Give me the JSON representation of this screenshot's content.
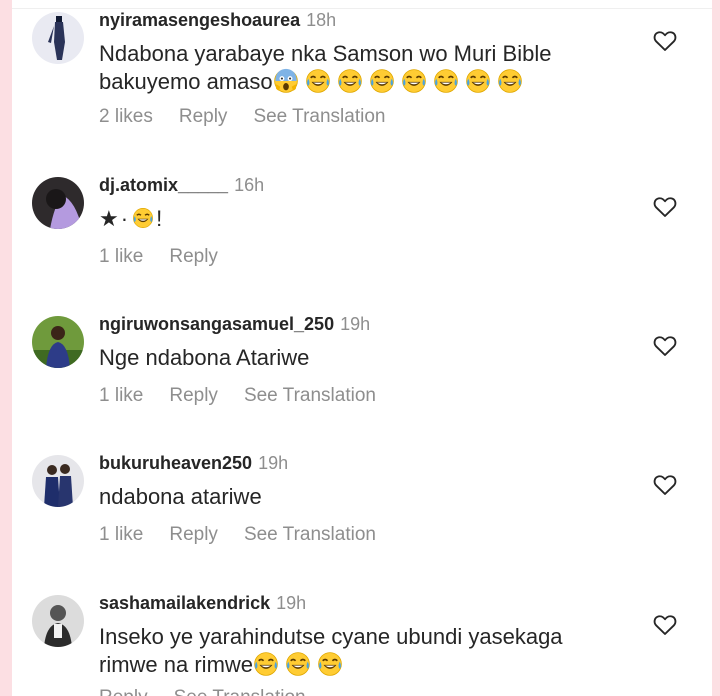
{
  "comments": [
    {
      "username": "nyiramasengeshoaurea",
      "time": "18h",
      "text": "Ndabona yarabaye nka Samson wo Muri Bible bakuyemo amaso",
      "emojis": [
        "scream",
        "joy",
        "joy",
        "joy",
        "joy",
        "joy",
        "joy",
        "joy"
      ],
      "likes": "2 likes",
      "reply": "Reply",
      "translation": "See Translation"
    },
    {
      "username": "dj.atomix_____",
      "time": "16h",
      "text_star": "★",
      "text_dot": "·",
      "text_end": "!",
      "likes": "1 like",
      "reply": "Reply"
    },
    {
      "username": "ngiruwonsangasamuel_250",
      "time": "19h",
      "text": "Nge ndabona Atariwe",
      "likes": "1 like",
      "reply": "Reply",
      "translation": "See Translation"
    },
    {
      "username": "bukuruheaven250",
      "time": "19h",
      "text": "ndabona atariwe",
      "likes": "1 like",
      "reply": "Reply",
      "translation": "See Translation"
    },
    {
      "username": "sashamailakendrick",
      "time": "19h",
      "text_line1": "Inseko ye yarahindutse cyane ubundi yasekaga",
      "text_line2": "rimwe na rimwe",
      "emojis": [
        "joy",
        "joy",
        "joy"
      ],
      "reply": "Reply",
      "translation": "See Translation"
    }
  ],
  "icons": {
    "heart": "heart-outline-icon",
    "emoji_joy": "face-with-tears-of-joy-icon",
    "emoji_scream": "face-screaming-in-fear-icon"
  },
  "colors": {
    "background": "#fcdfe3",
    "username": "#262626",
    "muted": "#8e8e8e",
    "emoji": "#ffcc33"
  }
}
